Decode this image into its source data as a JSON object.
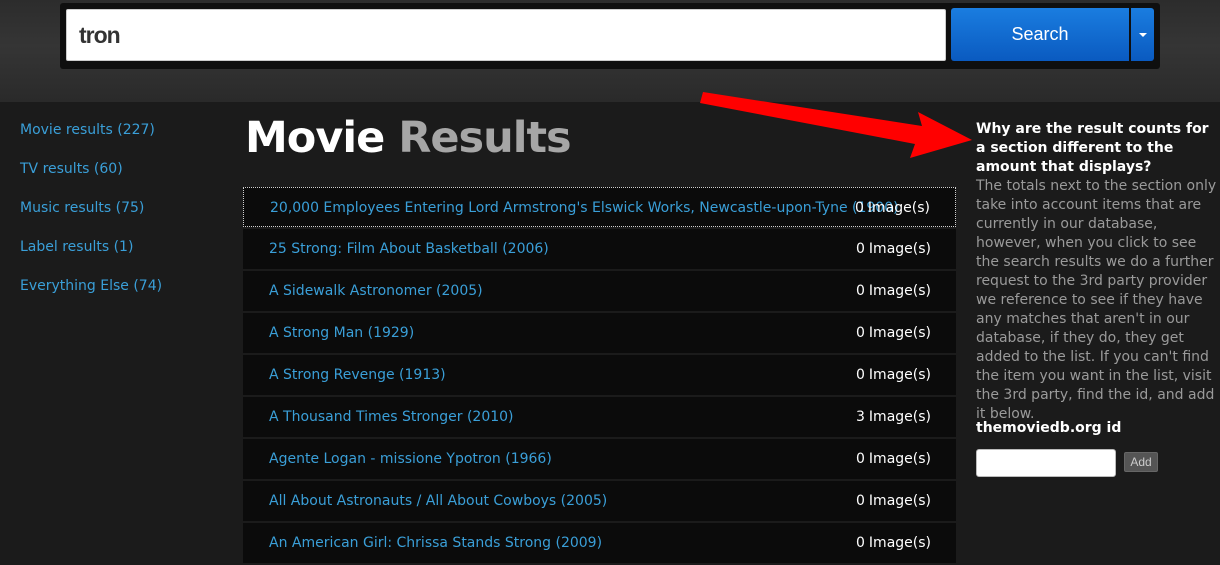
{
  "search": {
    "query": "tron",
    "button_label": "Search"
  },
  "sidebar": {
    "items": [
      {
        "label": "Movie results (227)"
      },
      {
        "label": "TV results (60)"
      },
      {
        "label": "Music results (75)"
      },
      {
        "label": "Label results (1)"
      },
      {
        "label": "Everything Else (74)"
      }
    ]
  },
  "main": {
    "title_primary": "Movie",
    "title_secondary": "Results",
    "count_suffix": "Image(s)",
    "results": [
      {
        "title": "20,000 Employees Entering Lord Armstrong's Elswick Works, Newcastle-upon-Tyne (1900)",
        "count": "0"
      },
      {
        "title": "25 Strong: Film About Basketball (2006)",
        "count": "0"
      },
      {
        "title": "A Sidewalk Astronomer (2005)",
        "count": "0"
      },
      {
        "title": "A Strong Man (1929)",
        "count": "0"
      },
      {
        "title": "A Strong Revenge (1913)",
        "count": "0"
      },
      {
        "title": "A Thousand Times Stronger (2010)",
        "count": "3"
      },
      {
        "title": "Agente Logan - missione Ypotron (1966)",
        "count": "0"
      },
      {
        "title": "All About Astronauts / All About Cowboys (2005)",
        "count": "0"
      },
      {
        "title": "An American Girl: Chrissa Stands Strong (2009)",
        "count": "0"
      }
    ]
  },
  "info": {
    "question": "Why are the result counts for a section different to the amount that displays?",
    "answer": "The totals next to the section only take into account items that are currently in our database, however, when you click to see the search results we do a further request to the 3rd party provider we reference to see if they have any matches that aren't in our database, if they do, they get added to the list. If you can't find the item you want in the list, visit the 3rd party, find the id, and add it below.",
    "id_label": "themoviedb.org id",
    "id_value": "",
    "add_label": "Add"
  },
  "colors": {
    "link": "#3a9fd8",
    "accent": "#0a6ad0",
    "arrow": "#ff0000"
  }
}
